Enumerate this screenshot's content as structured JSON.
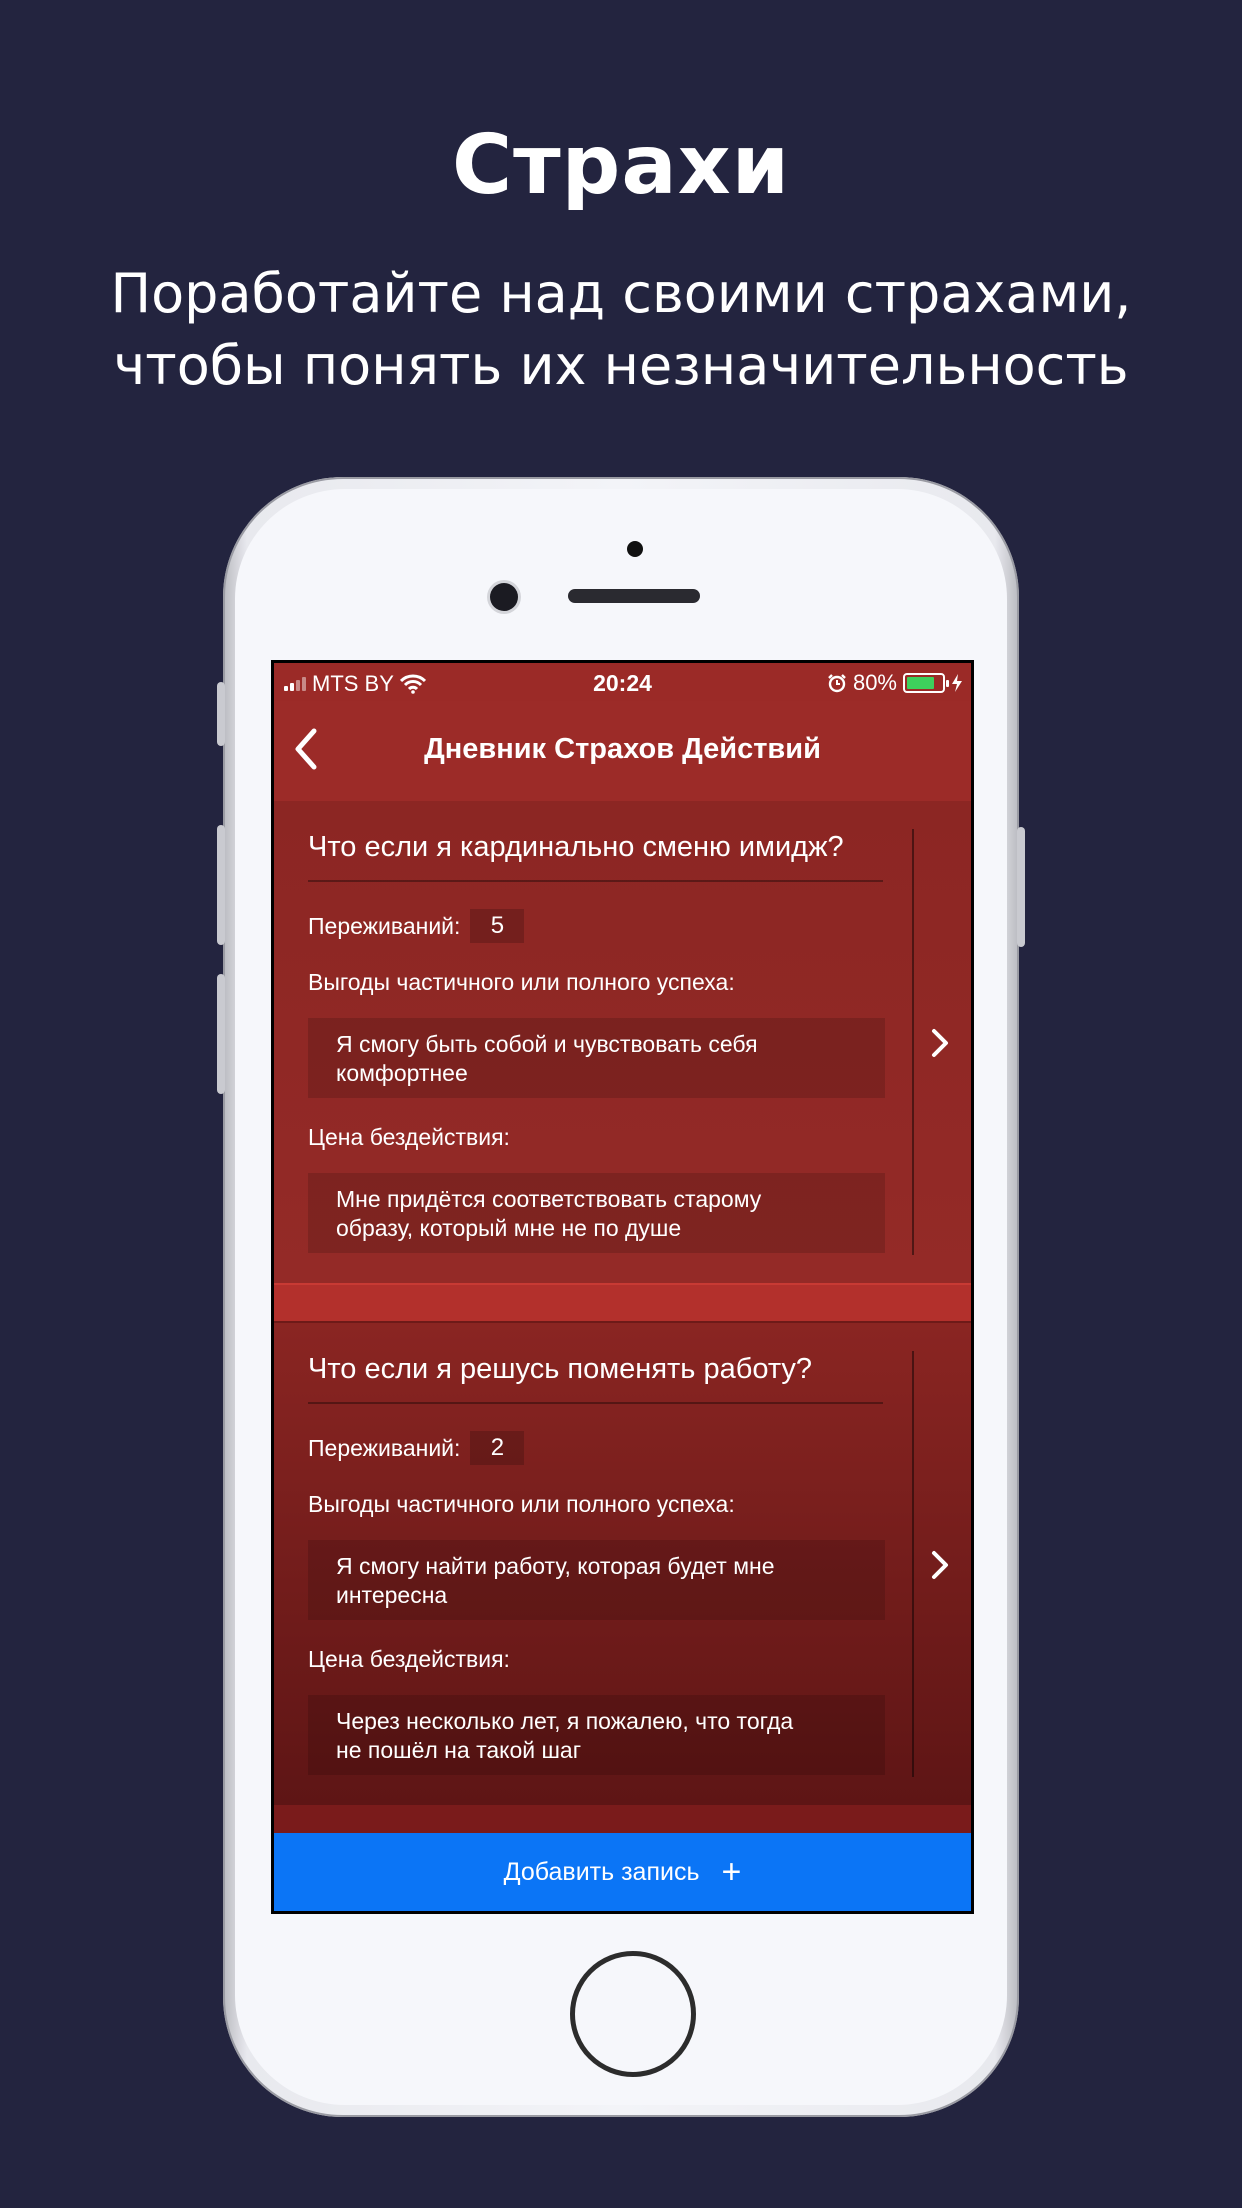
{
  "promo": {
    "title": "Страхи",
    "subtitle_line1": "Поработайте над своими страхами,",
    "subtitle_line2": "чтобы понять их незначительность"
  },
  "status_bar": {
    "carrier": "MTS BY",
    "time": "20:24",
    "battery": "80%",
    "battery_level": 0.8,
    "icons": [
      "signal-icon",
      "wifi-icon",
      "alarm-icon",
      "battery-icon",
      "charging-icon"
    ]
  },
  "nav": {
    "back_icon": "chevron-left-icon",
    "title": "Дневник Страхов Действий"
  },
  "entries": [
    {
      "question": "Что если я кардинально сменю имидж?",
      "experiences_label": "Переживаний:",
      "experiences_value": "5",
      "benefits_label": "Выгоды частичного или полного успеха:",
      "benefits_line1": "Я смогу быть собой и чувствовать себя",
      "benefits_line2": "комфортнее",
      "cost_label": "Цена бездействия:",
      "cost_line1": "Мне придётся соответствовать старому",
      "cost_line2": "образу, который мне не по душе"
    },
    {
      "question": "Что если я решусь поменять работу?",
      "experiences_label": "Переживаний:",
      "experiences_value": "2",
      "benefits_label": "Выгоды частичного или полного успеха:",
      "benefits_line1": "Я смогу найти работу, которая будет мне",
      "benefits_line2": "интересна",
      "cost_label": "Цена бездействия:",
      "cost_line1": "Через несколько лет, я пожалею, что тогда",
      "cost_line2": "не пошёл на такой шаг"
    }
  ],
  "add_button": {
    "label": "Добавить запись",
    "icon": "+"
  },
  "colors": {
    "background": "#23243f",
    "header_red": "#9c2b28",
    "accent_blue": "#0b75f6",
    "battery_green": "#3ed05c"
  }
}
